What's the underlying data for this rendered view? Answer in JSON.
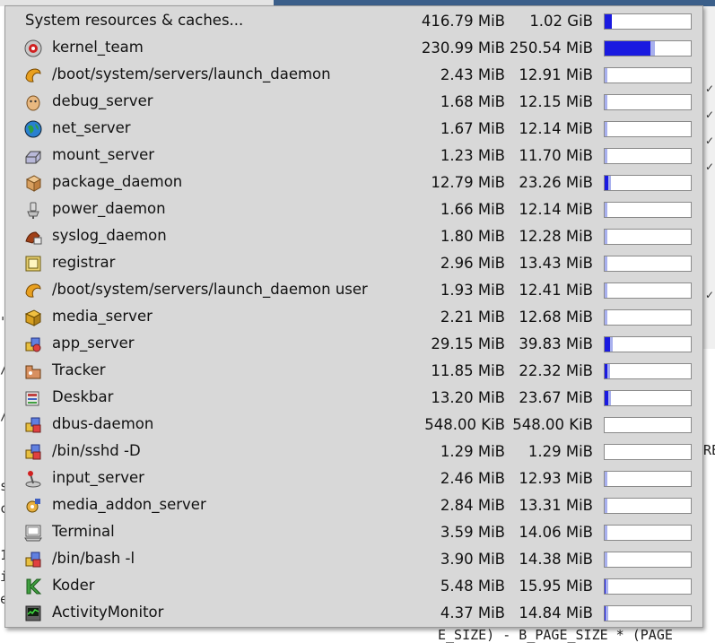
{
  "menu": {
    "header": {
      "label": "System resources & caches...",
      "memory": "416.79 MiB",
      "total": "1.02 GiB",
      "used_fraction": 0.08,
      "cache_fraction": 0.0
    },
    "items": [
      {
        "label": "kernel_team",
        "memory": "230.99 MiB",
        "total": "250.54 MiB",
        "icon": "kernel-icon",
        "used_fraction": 0.53,
        "cache_fraction": 0.05
      },
      {
        "label": "/boot/system/servers/launch_daemon",
        "memory": "2.43 MiB",
        "total": "12.91 MiB",
        "icon": "launch-daemon-icon",
        "used_fraction": 0.0,
        "cache_fraction": 0.03
      },
      {
        "label": "debug_server",
        "memory": "1.68 MiB",
        "total": "12.15 MiB",
        "icon": "debug-server-icon",
        "used_fraction": 0.0,
        "cache_fraction": 0.03
      },
      {
        "label": "net_server",
        "memory": "1.67 MiB",
        "total": "12.14 MiB",
        "icon": "globe-icon",
        "used_fraction": 0.0,
        "cache_fraction": 0.03
      },
      {
        "label": "mount_server",
        "memory": "1.23 MiB",
        "total": "11.70 MiB",
        "icon": "drive-icon",
        "used_fraction": 0.0,
        "cache_fraction": 0.03
      },
      {
        "label": "package_daemon",
        "memory": "12.79 MiB",
        "total": "23.26 MiB",
        "icon": "package-icon",
        "used_fraction": 0.04,
        "cache_fraction": 0.03
      },
      {
        "label": "power_daemon",
        "memory": "1.66 MiB",
        "total": "12.14 MiB",
        "icon": "power-plug-icon",
        "used_fraction": 0.0,
        "cache_fraction": 0.03
      },
      {
        "label": "syslog_daemon",
        "memory": "1.80 MiB",
        "total": "12.28 MiB",
        "icon": "syslog-icon",
        "used_fraction": 0.0,
        "cache_fraction": 0.03
      },
      {
        "label": "registrar",
        "memory": "2.96 MiB",
        "total": "13.43 MiB",
        "icon": "registrar-icon",
        "used_fraction": 0.0,
        "cache_fraction": 0.03
      },
      {
        "label": "/boot/system/servers/launch_daemon user",
        "memory": "1.93 MiB",
        "total": "12.41 MiB",
        "icon": "launch-daemon-icon",
        "used_fraction": 0.0,
        "cache_fraction": 0.03
      },
      {
        "label": "media_server",
        "memory": "2.21 MiB",
        "total": "12.68 MiB",
        "icon": "media-server-icon",
        "used_fraction": 0.0,
        "cache_fraction": 0.03
      },
      {
        "label": "app_server",
        "memory": "29.15 MiB",
        "total": "39.83 MiB",
        "icon": "app-server-icon",
        "used_fraction": 0.06,
        "cache_fraction": 0.03
      },
      {
        "label": "Tracker",
        "memory": "11.85 MiB",
        "total": "22.32 MiB",
        "icon": "tracker-icon",
        "used_fraction": 0.03,
        "cache_fraction": 0.03
      },
      {
        "label": "Deskbar",
        "memory": "13.20 MiB",
        "total": "23.67 MiB",
        "icon": "deskbar-icon",
        "used_fraction": 0.04,
        "cache_fraction": 0.03
      },
      {
        "label": "dbus-daemon",
        "memory": "548.00 KiB",
        "total": "548.00 KiB",
        "icon": "blocks-icon",
        "used_fraction": 0.0,
        "cache_fraction": 0.0
      },
      {
        "label": "/bin/sshd -D",
        "memory": "1.29 MiB",
        "total": "1.29 MiB",
        "icon": "blocks-icon",
        "used_fraction": 0.0,
        "cache_fraction": 0.0
      },
      {
        "label": "input_server",
        "memory": "2.46 MiB",
        "total": "12.93 MiB",
        "icon": "joystick-icon",
        "used_fraction": 0.0,
        "cache_fraction": 0.03
      },
      {
        "label": "media_addon_server",
        "memory": "2.84 MiB",
        "total": "13.31 MiB",
        "icon": "media-addon-icon",
        "used_fraction": 0.0,
        "cache_fraction": 0.03
      },
      {
        "label": "Terminal",
        "memory": "3.59 MiB",
        "total": "14.06 MiB",
        "icon": "terminal-icon",
        "used_fraction": 0.0,
        "cache_fraction": 0.03
      },
      {
        "label": "/bin/bash -l",
        "memory": "3.90 MiB",
        "total": "14.38 MiB",
        "icon": "blocks-icon",
        "used_fraction": 0.0,
        "cache_fraction": 0.03
      },
      {
        "label": "Koder",
        "memory": "5.48 MiB",
        "total": "15.95 MiB",
        "icon": "koder-icon",
        "used_fraction": 0.01,
        "cache_fraction": 0.03
      },
      {
        "label": "ActivityMonitor",
        "memory": "4.37 MiB",
        "total": "14.84 MiB",
        "icon": "activity-monitor-icon",
        "used_fraction": 0.01,
        "cache_fraction": 0.03
      }
    ]
  },
  "background": {
    "text_fragment": "E_SIZE) - B_PAGE_SIZE * (PAGE",
    "right_fragment": "RE",
    "left_glyphs": [
      "\"",
      "/",
      "/",
      "s",
      "c",
      "1",
      "i",
      "e"
    ],
    "check_glyph": "✓"
  },
  "colors": {
    "used": "#1a1ae0",
    "cache": "#a8b0ee",
    "menu_bg": "#d8d8d8"
  }
}
